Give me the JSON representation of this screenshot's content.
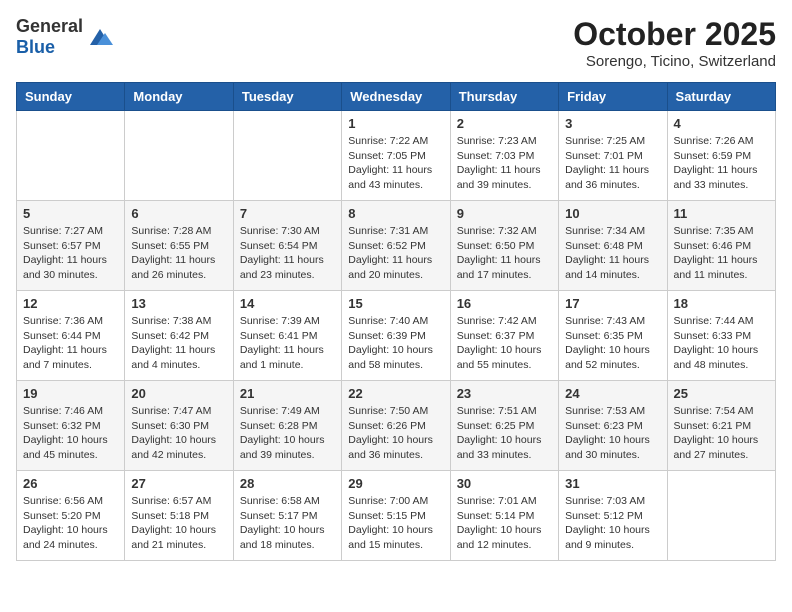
{
  "header": {
    "logo_general": "General",
    "logo_blue": "Blue",
    "month_title": "October 2025",
    "location": "Sorengo, Ticino, Switzerland"
  },
  "days_of_week": [
    "Sunday",
    "Monday",
    "Tuesday",
    "Wednesday",
    "Thursday",
    "Friday",
    "Saturday"
  ],
  "weeks": [
    [
      {
        "day": "",
        "info": ""
      },
      {
        "day": "",
        "info": ""
      },
      {
        "day": "",
        "info": ""
      },
      {
        "day": "1",
        "info": "Sunrise: 7:22 AM\nSunset: 7:05 PM\nDaylight: 11 hours and 43 minutes."
      },
      {
        "day": "2",
        "info": "Sunrise: 7:23 AM\nSunset: 7:03 PM\nDaylight: 11 hours and 39 minutes."
      },
      {
        "day": "3",
        "info": "Sunrise: 7:25 AM\nSunset: 7:01 PM\nDaylight: 11 hours and 36 minutes."
      },
      {
        "day": "4",
        "info": "Sunrise: 7:26 AM\nSunset: 6:59 PM\nDaylight: 11 hours and 33 minutes."
      }
    ],
    [
      {
        "day": "5",
        "info": "Sunrise: 7:27 AM\nSunset: 6:57 PM\nDaylight: 11 hours and 30 minutes."
      },
      {
        "day": "6",
        "info": "Sunrise: 7:28 AM\nSunset: 6:55 PM\nDaylight: 11 hours and 26 minutes."
      },
      {
        "day": "7",
        "info": "Sunrise: 7:30 AM\nSunset: 6:54 PM\nDaylight: 11 hours and 23 minutes."
      },
      {
        "day": "8",
        "info": "Sunrise: 7:31 AM\nSunset: 6:52 PM\nDaylight: 11 hours and 20 minutes."
      },
      {
        "day": "9",
        "info": "Sunrise: 7:32 AM\nSunset: 6:50 PM\nDaylight: 11 hours and 17 minutes."
      },
      {
        "day": "10",
        "info": "Sunrise: 7:34 AM\nSunset: 6:48 PM\nDaylight: 11 hours and 14 minutes."
      },
      {
        "day": "11",
        "info": "Sunrise: 7:35 AM\nSunset: 6:46 PM\nDaylight: 11 hours and 11 minutes."
      }
    ],
    [
      {
        "day": "12",
        "info": "Sunrise: 7:36 AM\nSunset: 6:44 PM\nDaylight: 11 hours and 7 minutes."
      },
      {
        "day": "13",
        "info": "Sunrise: 7:38 AM\nSunset: 6:42 PM\nDaylight: 11 hours and 4 minutes."
      },
      {
        "day": "14",
        "info": "Sunrise: 7:39 AM\nSunset: 6:41 PM\nDaylight: 11 hours and 1 minute."
      },
      {
        "day": "15",
        "info": "Sunrise: 7:40 AM\nSunset: 6:39 PM\nDaylight: 10 hours and 58 minutes."
      },
      {
        "day": "16",
        "info": "Sunrise: 7:42 AM\nSunset: 6:37 PM\nDaylight: 10 hours and 55 minutes."
      },
      {
        "day": "17",
        "info": "Sunrise: 7:43 AM\nSunset: 6:35 PM\nDaylight: 10 hours and 52 minutes."
      },
      {
        "day": "18",
        "info": "Sunrise: 7:44 AM\nSunset: 6:33 PM\nDaylight: 10 hours and 48 minutes."
      }
    ],
    [
      {
        "day": "19",
        "info": "Sunrise: 7:46 AM\nSunset: 6:32 PM\nDaylight: 10 hours and 45 minutes."
      },
      {
        "day": "20",
        "info": "Sunrise: 7:47 AM\nSunset: 6:30 PM\nDaylight: 10 hours and 42 minutes."
      },
      {
        "day": "21",
        "info": "Sunrise: 7:49 AM\nSunset: 6:28 PM\nDaylight: 10 hours and 39 minutes."
      },
      {
        "day": "22",
        "info": "Sunrise: 7:50 AM\nSunset: 6:26 PM\nDaylight: 10 hours and 36 minutes."
      },
      {
        "day": "23",
        "info": "Sunrise: 7:51 AM\nSunset: 6:25 PM\nDaylight: 10 hours and 33 minutes."
      },
      {
        "day": "24",
        "info": "Sunrise: 7:53 AM\nSunset: 6:23 PM\nDaylight: 10 hours and 30 minutes."
      },
      {
        "day": "25",
        "info": "Sunrise: 7:54 AM\nSunset: 6:21 PM\nDaylight: 10 hours and 27 minutes."
      }
    ],
    [
      {
        "day": "26",
        "info": "Sunrise: 6:56 AM\nSunset: 5:20 PM\nDaylight: 10 hours and 24 minutes."
      },
      {
        "day": "27",
        "info": "Sunrise: 6:57 AM\nSunset: 5:18 PM\nDaylight: 10 hours and 21 minutes."
      },
      {
        "day": "28",
        "info": "Sunrise: 6:58 AM\nSunset: 5:17 PM\nDaylight: 10 hours and 18 minutes."
      },
      {
        "day": "29",
        "info": "Sunrise: 7:00 AM\nSunset: 5:15 PM\nDaylight: 10 hours and 15 minutes."
      },
      {
        "day": "30",
        "info": "Sunrise: 7:01 AM\nSunset: 5:14 PM\nDaylight: 10 hours and 12 minutes."
      },
      {
        "day": "31",
        "info": "Sunrise: 7:03 AM\nSunset: 5:12 PM\nDaylight: 10 hours and 9 minutes."
      },
      {
        "day": "",
        "info": ""
      }
    ]
  ]
}
